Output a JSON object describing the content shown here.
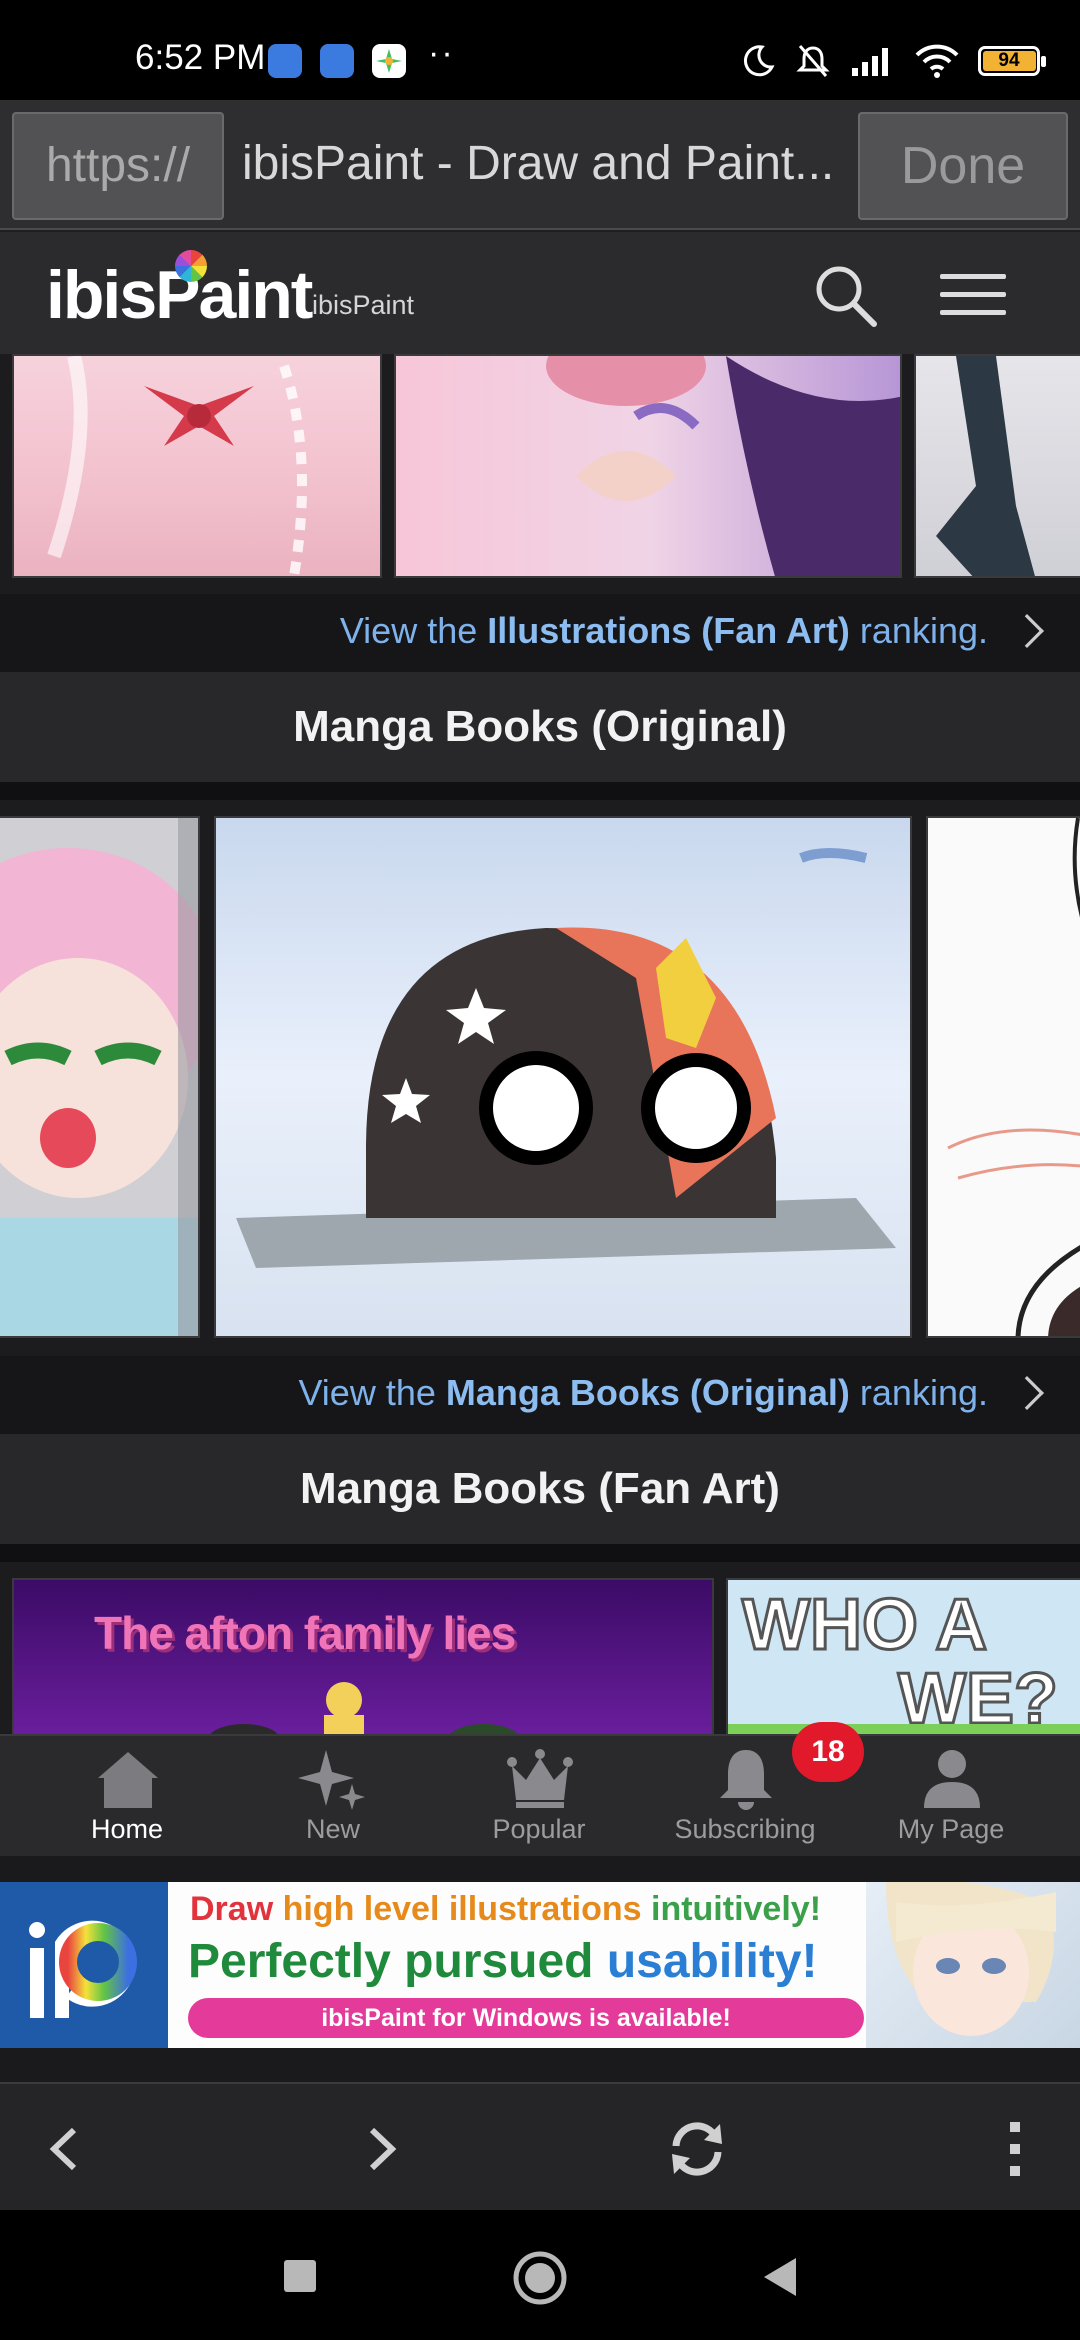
{
  "status_bar": {
    "time": "6:52 PM",
    "dots": "··",
    "battery": "94"
  },
  "url_bar": {
    "scheme": "https://",
    "title": "ibisPaint - Draw and Paint...",
    "done": "Done"
  },
  "site_header": {
    "logo_pre": "ibis",
    "logo_p": "P",
    "logo_post": "aint",
    "logo_sub": "ibisPaint"
  },
  "sections": {
    "illustrations_fan_art": {
      "ranking_prefix": "View the ",
      "ranking_bold": "Illustrations (Fan Art)",
      "ranking_suffix": " ranking."
    },
    "manga_original": {
      "title": "Manga Books (Original)",
      "ranking_prefix": "View the ",
      "ranking_bold": "Manga Books (Original)",
      "ranking_suffix": " ranking."
    },
    "manga_fan_art": {
      "title": "Manga Books (Fan Art)",
      "thumb1_text": "The afton family lies",
      "thumb2_line1": "WHO A",
      "thumb2_line2": "WE?"
    }
  },
  "bottom_nav": {
    "items": [
      {
        "label": "Home",
        "icon": "home-icon"
      },
      {
        "label": "New",
        "icon": "sparkle-icon"
      },
      {
        "label": "Popular",
        "icon": "crown-icon"
      },
      {
        "label": "Subscribing",
        "icon": "bell-icon"
      },
      {
        "label": "My Page",
        "icon": "person-icon"
      }
    ],
    "badge": "18",
    "active": "Home"
  },
  "banner": {
    "line1_w1": "Draw ",
    "line1_w2": "high level illustrations ",
    "line1_w3": "intuitively!",
    "line2_w1": "Perfectly pursued ",
    "line2_w2": "usability!",
    "button": "ibisPaint for Windows is available!"
  },
  "colors": {
    "link": "#7fb2ea",
    "badge": "#e1192b",
    "banner_pink": "#e43b9a",
    "banner_green": "#1f8a3b",
    "battery": "#f2b233"
  }
}
